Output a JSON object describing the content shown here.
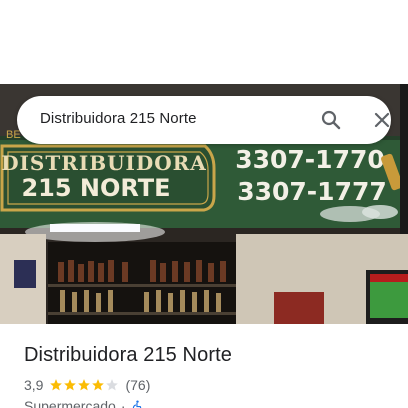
{
  "search": {
    "query": "Distribuidora 215 Norte"
  },
  "photo": {
    "sign_name_line1": "DISTRIBUIDORA",
    "sign_name_line2": "215 NORTE",
    "sign_partial_left": "BE",
    "phone1": "3307-1770",
    "phone2": "3307-1777"
  },
  "place": {
    "title": "Distribuidora 215 Norte",
    "rating": "3,9",
    "stars_filled": 4,
    "stars_total": 5,
    "review_count": "(76)",
    "category": "Supermercado",
    "separator": "·"
  },
  "colors": {
    "sign_green": "#2f5a37",
    "sign_gold": "#c9a64a",
    "star_gold": "#fbbc04",
    "star_empty": "#dadce0",
    "text_primary": "#202124",
    "text_secondary": "#5f6368",
    "accessible_blue": "#1a73e8"
  },
  "icons": {
    "search": "search-icon",
    "close": "close-icon",
    "accessibility": "wheelchair-icon"
  }
}
